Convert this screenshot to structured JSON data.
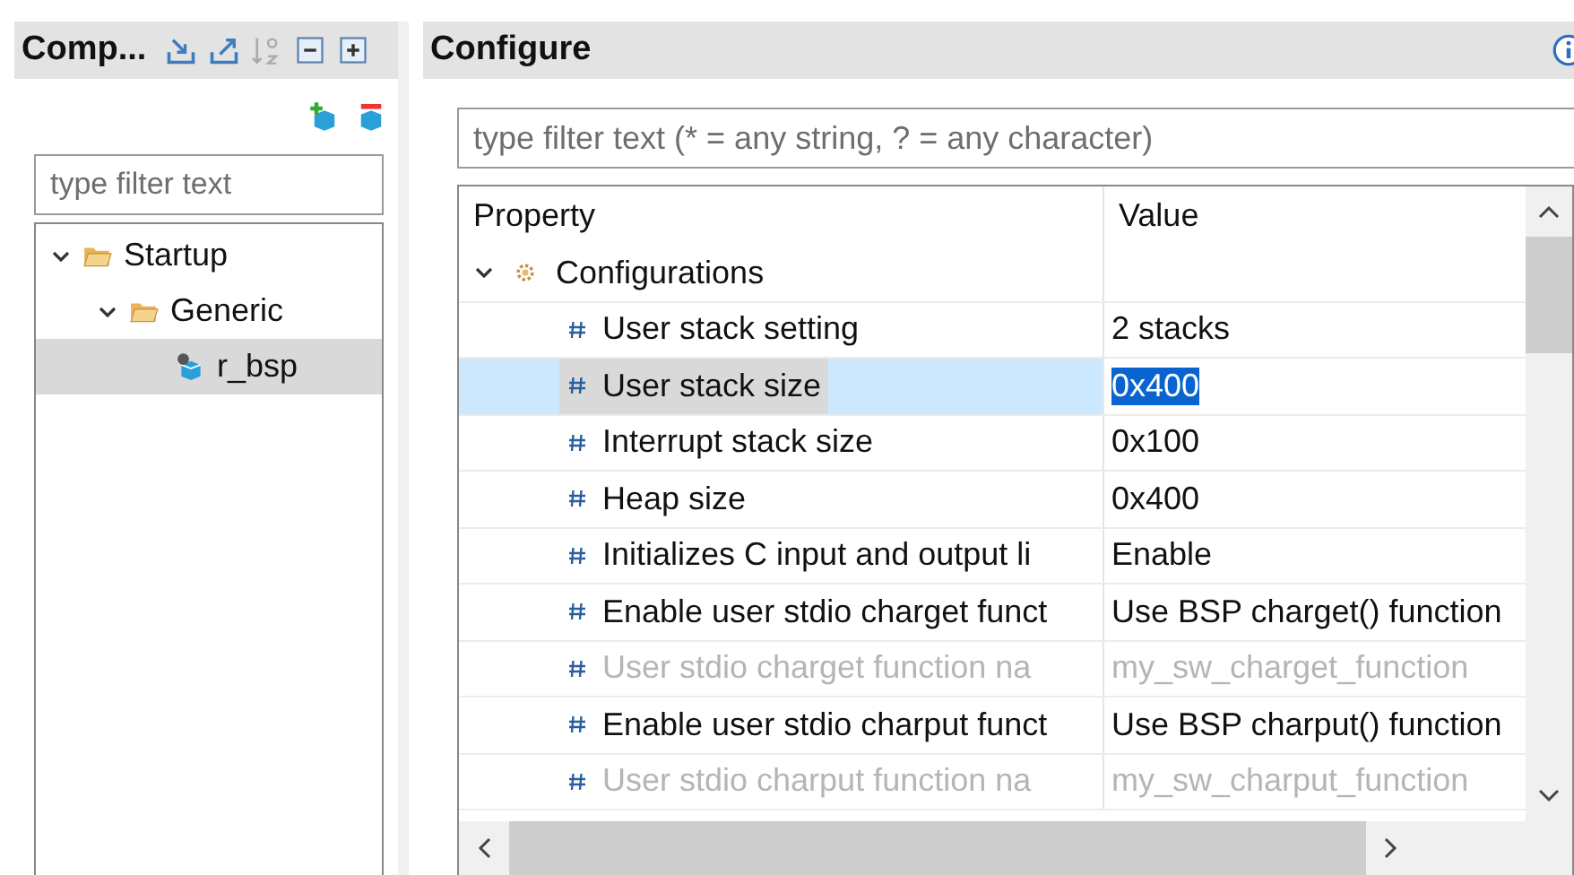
{
  "components_panel": {
    "title": "Comp...",
    "filter": {
      "placeholder": "type filter text"
    },
    "tree": [
      {
        "label": "Startup",
        "expanded": true,
        "children": [
          {
            "label": "Generic",
            "expanded": true,
            "children": [
              {
                "label": "r_bsp",
                "selected": true
              }
            ]
          }
        ]
      }
    ]
  },
  "configure_panel": {
    "title": "Configure",
    "filter": {
      "placeholder": "type filter text (* = any string, ? = any character)"
    },
    "table": {
      "columns": [
        "Property",
        "Value"
      ],
      "groups": [
        {
          "label": "Configurations",
          "expanded": true,
          "rows": [
            {
              "property": "User stack setting",
              "value": "2 stacks",
              "disabled": false,
              "selected": false
            },
            {
              "property": "User stack size",
              "value": "0x400",
              "disabled": false,
              "selected": true
            },
            {
              "property": "Interrupt stack size",
              "value": "0x100",
              "disabled": false,
              "selected": false
            },
            {
              "property": "Heap size",
              "value": "0x400",
              "disabled": false,
              "selected": false
            },
            {
              "property": "Initializes C input and output li",
              "value": "Enable",
              "disabled": false,
              "selected": false
            },
            {
              "property": "Enable user stdio charget funct",
              "value": "Use BSP charget() function",
              "disabled": false,
              "selected": false
            },
            {
              "property": "User stdio charget function na",
              "value": "my_sw_charget_function",
              "disabled": true,
              "selected": false
            },
            {
              "property": "Enable user stdio charput funct",
              "value": "Use BSP charput() function",
              "disabled": false,
              "selected": false
            },
            {
              "property": "User stdio charput function na",
              "value": "my_sw_charput_function",
              "disabled": true,
              "selected": false
            }
          ]
        }
      ]
    }
  }
}
